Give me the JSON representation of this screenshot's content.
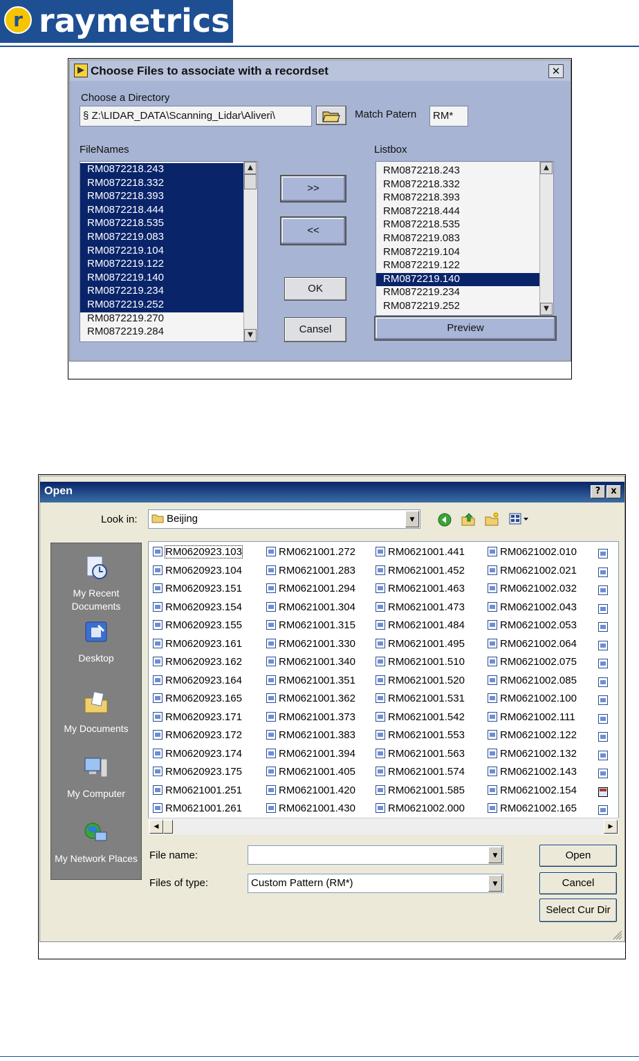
{
  "logo": {
    "mark": "r",
    "text": "raymetrics"
  },
  "dialog1": {
    "title": "Choose Files to associate with a recordset",
    "directory_label": "Choose a Directory",
    "directory_value": "Z:\\LIDAR_DATA\\Scanning_Lidar\\Aliveri\\",
    "path_prefix_glyph": "§",
    "match_label": "Match Patern",
    "match_value": "RM*",
    "filenames_label": "FileNames",
    "listbox_label": "Listbox",
    "buttons": {
      "add": ">>",
      "remove": "<<",
      "ok": "OK",
      "cancel": "Cansel",
      "preview": "Preview"
    },
    "filenames": [
      {
        "name": "RM0872218.243",
        "selected": true
      },
      {
        "name": "RM0872218.332",
        "selected": true
      },
      {
        "name": "RM0872218.393",
        "selected": true
      },
      {
        "name": "RM0872218.444",
        "selected": true
      },
      {
        "name": "RM0872218.535",
        "selected": true
      },
      {
        "name": "RM0872219.083",
        "selected": true
      },
      {
        "name": "RM0872219.104",
        "selected": true
      },
      {
        "name": "RM0872219.122",
        "selected": true
      },
      {
        "name": "RM0872219.140",
        "selected": true
      },
      {
        "name": "RM0872219.234",
        "selected": true
      },
      {
        "name": "RM0872219.252",
        "selected": true
      },
      {
        "name": "RM0872219.270",
        "selected": false
      },
      {
        "name": "RM0872219.284",
        "selected": false
      }
    ],
    "listbox": [
      {
        "name": "RM0872218.243",
        "selected": false
      },
      {
        "name": "RM0872218.332",
        "selected": false
      },
      {
        "name": "RM0872218.393",
        "selected": false
      },
      {
        "name": "RM0872218.444",
        "selected": false
      },
      {
        "name": "RM0872218.535",
        "selected": false
      },
      {
        "name": "RM0872219.083",
        "selected": false
      },
      {
        "name": "RM0872219.104",
        "selected": false
      },
      {
        "name": "RM0872219.122",
        "selected": false
      },
      {
        "name": "RM0872219.140",
        "selected": true
      },
      {
        "name": "RM0872219.234",
        "selected": false
      },
      {
        "name": "RM0872219.252",
        "selected": false
      }
    ]
  },
  "dialog2": {
    "title": "Open",
    "help_btn": "?",
    "close_btn": "x",
    "look_in_label": "Look in:",
    "look_in_value": "Beijing",
    "places": [
      "My Recent Documents",
      "Desktop",
      "My Documents",
      "My Computer",
      "My Network Places"
    ],
    "columns": [
      [
        "RM0620923.103",
        "RM0620923.104",
        "RM0620923.151",
        "RM0620923.154",
        "RM0620923.155",
        "RM0620923.161",
        "RM0620923.162",
        "RM0620923.164",
        "RM0620923.165",
        "RM0620923.171",
        "RM0620923.172",
        "RM0620923.174",
        "RM0620923.175",
        "RM0621001.251",
        "RM0621001.261"
      ],
      [
        "RM0621001.272",
        "RM0621001.283",
        "RM0621001.294",
        "RM0621001.304",
        "RM0621001.315",
        "RM0621001.330",
        "RM0621001.340",
        "RM0621001.351",
        "RM0621001.362",
        "RM0621001.373",
        "RM0621001.383",
        "RM0621001.394",
        "RM0621001.405",
        "RM0621001.420",
        "RM0621001.430"
      ],
      [
        "RM0621001.441",
        "RM0621001.452",
        "RM0621001.463",
        "RM0621001.473",
        "RM0621001.484",
        "RM0621001.495",
        "RM0621001.510",
        "RM0621001.520",
        "RM0621001.531",
        "RM0621001.542",
        "RM0621001.553",
        "RM0621001.563",
        "RM0621001.574",
        "RM0621001.585",
        "RM0621002.000"
      ],
      [
        "RM0621002.010",
        "RM0621002.021",
        "RM0621002.032",
        "RM0621002.043",
        "RM0621002.053",
        "RM0621002.064",
        "RM0621002.075",
        "RM0621002.085",
        "RM0621002.100",
        "RM0621002.111",
        "RM0621002.122",
        "RM0621002.132",
        "RM0621002.143",
        "RM0621002.154",
        "RM0621002.165"
      ]
    ],
    "file_name_label": "File name:",
    "file_name_value": "",
    "files_of_type_label": "Files of type:",
    "files_of_type_value": "Custom Pattern (RM*)",
    "buttons": {
      "open": "Open",
      "cancel": "Cancel",
      "select_dir": "Select Cur Dir"
    }
  }
}
